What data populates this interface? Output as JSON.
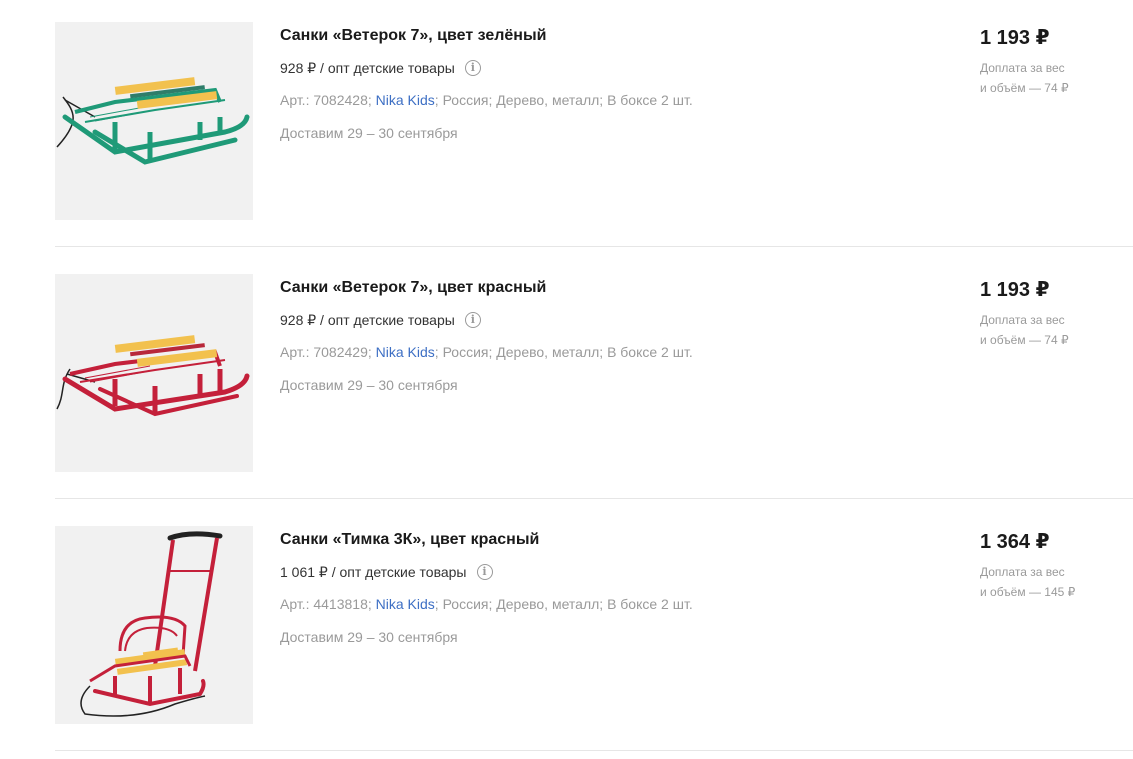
{
  "products": [
    {
      "title": "Санки «Ветерок 7», цвет зелёный",
      "opt_price": "928 ₽ / опт детские товары",
      "article": "Арт.: 7082428;",
      "brand": "Nika Kids",
      "country": "Россия;",
      "material": "Дерево, металл;",
      "box": "В боксе 2 шт.",
      "delivery": "Доставим 29 – 30 сентября",
      "price": "1 193 ₽",
      "surcharge_line1": "Доплата за вес",
      "surcharge_line2": "и объём — 74 ₽",
      "image_icon": "green-sled-image",
      "frame_color": "#1f9a78"
    },
    {
      "title": "Санки «Ветерок 7», цвет красный",
      "opt_price": "928 ₽ / опт детские товары",
      "article": "Арт.: 7082429;",
      "brand": "Nika Kids",
      "country": "Россия;",
      "material": "Дерево, металл;",
      "box": "В боксе 2 шт.",
      "delivery": "Доставим 29 – 30 сентября",
      "price": "1 193 ₽",
      "surcharge_line1": "Доплата за вес",
      "surcharge_line2": "и объём — 74 ₽",
      "image_icon": "red-sled-image",
      "frame_color": "#c4203a"
    },
    {
      "title": "Санки «Тимка 3К», цвет красный",
      "opt_price": "1 061 ₽ / опт детские товары",
      "article": "Арт.: 4413818;",
      "brand": "Nika Kids",
      "country": "Россия;",
      "material": "Дерево, металл;",
      "box": "В боксе 2 шт.",
      "delivery": "Доставим 29 – 30 сентября",
      "price": "1 364 ₽",
      "surcharge_line1": "Доплата за вес",
      "surcharge_line2": "и объём — 145 ₽",
      "image_icon": "red-sled-with-handle-image",
      "frame_color": "#c4203a"
    }
  ],
  "colors": {
    "brand_link": "#3d6fc4",
    "muted_text": "#9a9a9a",
    "wood": "#f2c14e"
  }
}
